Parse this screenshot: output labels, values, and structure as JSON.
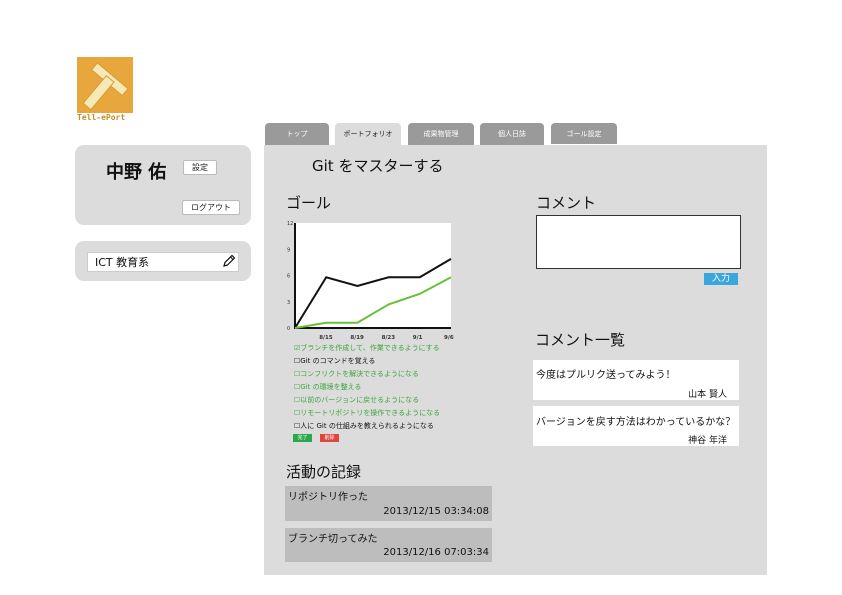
{
  "logo": {
    "text": "Tell-ePort",
    "letter": "T"
  },
  "user": {
    "name": "中野 佑",
    "settings_label": "設定",
    "logout_label": "ログアウト"
  },
  "group": {
    "name": "ICT 教育系"
  },
  "tabs": [
    {
      "label": "トップ",
      "active": false
    },
    {
      "label": "ポートフォリオ",
      "active": true
    },
    {
      "label": "成果物管理",
      "active": false
    },
    {
      "label": "個人日誌",
      "active": false
    },
    {
      "label": "ゴール設定",
      "active": false
    }
  ],
  "goal": {
    "title": "Git をマスターする",
    "section_label": "ゴール",
    "tasks": [
      {
        "text": "☑ブランチを作成して、作業できるようにする",
        "color": "#3aa53a"
      },
      {
        "text": "☐Git のコマンドを覚える",
        "color": "#111111"
      },
      {
        "text": "☐コンフリクトを解決できるようになる",
        "color": "#3aa53a"
      },
      {
        "text": "☐Git の環境を整える",
        "color": "#3aa53a"
      },
      {
        "text": "☐以前のバージョンに戻せるようになる",
        "color": "#3aa53a"
      },
      {
        "text": "☐リモートリポジトリを操作できるようになる",
        "color": "#3aa53a"
      },
      {
        "text": "☐人に Git の仕組みを教えられるようになる",
        "color": "#111111"
      }
    ],
    "done_label": "完了",
    "delete_label": "削除"
  },
  "chart_data": {
    "type": "line",
    "categories": [
      "",
      "8/15",
      "8/19",
      "8/23",
      "9/1",
      "9/6"
    ],
    "x_tick_labels": [
      "8/15",
      "8/19",
      "8/23",
      "9/1",
      "9/6"
    ],
    "y_ticks": [
      "12",
      "9",
      "6",
      "3",
      "0"
    ],
    "ylim": [
      0,
      12
    ],
    "series": [
      {
        "color": "#111111",
        "values": [
          0,
          5.8,
          4.8,
          5.8,
          5.8,
          7.9
        ]
      },
      {
        "color": "#6abf3a",
        "values": [
          0,
          0.6,
          0.6,
          2.7,
          3.9,
          5.8
        ]
      }
    ]
  },
  "comment": {
    "section_label": "コメント",
    "submit_label": "入力",
    "list_label": "コメント一覧",
    "items": [
      {
        "text": "今度はプルリク送ってみよう！",
        "author": "山本 賢人"
      },
      {
        "text": "バージョンを戻す方法はわかっているかな？",
        "author": "神谷 年洋"
      }
    ]
  },
  "activity": {
    "section_label": "活動の記録",
    "items": [
      {
        "text": "リポジトリ作った",
        "time": "2013/12/15 03:34:08"
      },
      {
        "text": "ブランチ切ってみた",
        "time": "2013/12/16 07:03:34"
      }
    ]
  }
}
